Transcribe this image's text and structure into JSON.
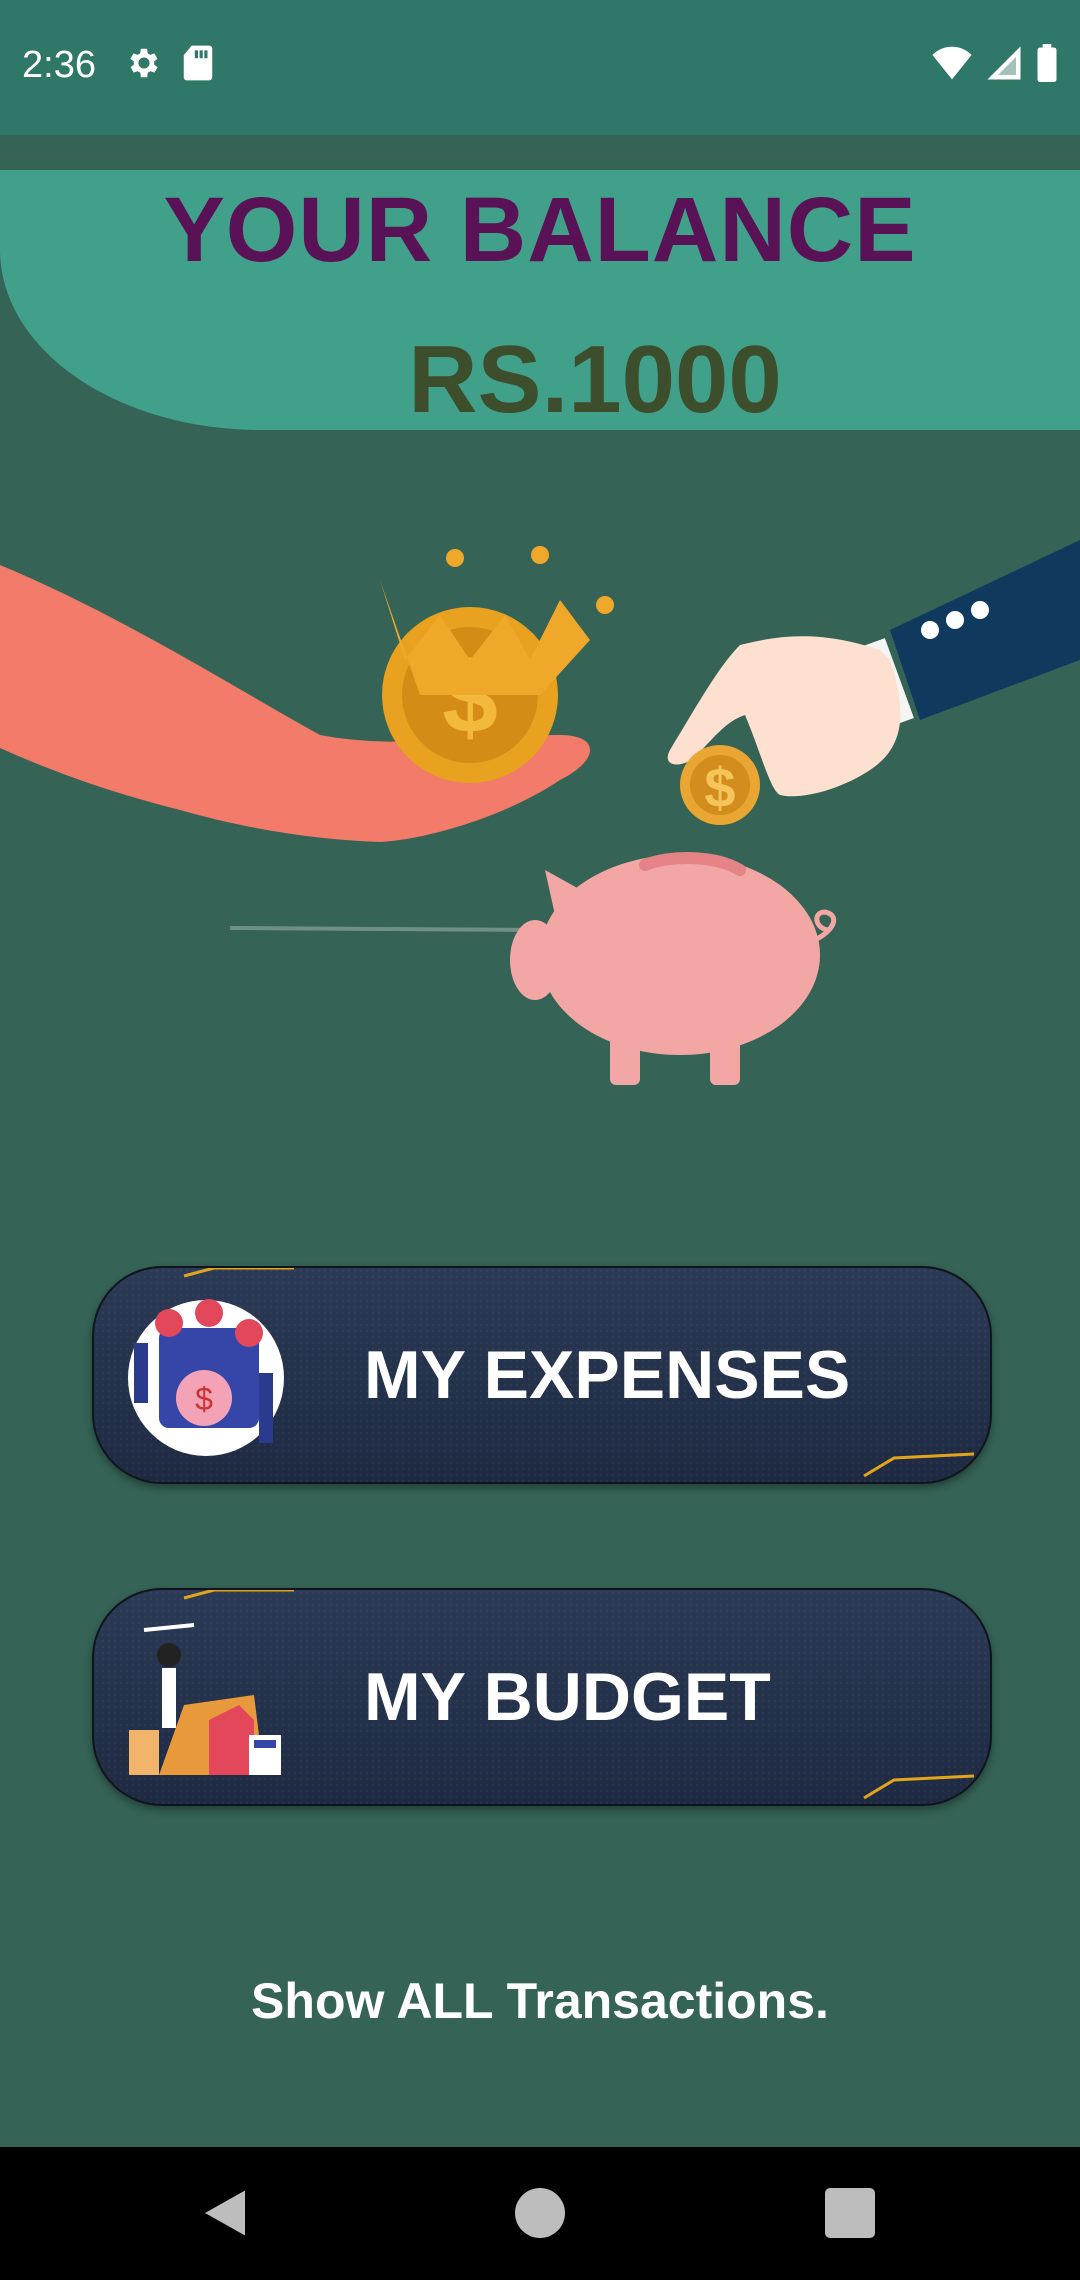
{
  "status_bar": {
    "time": "2:36",
    "left_icons": [
      "gear-icon",
      "sd-card-icon"
    ],
    "right_icons": [
      "wifi-icon",
      "signal-icon",
      "battery-icon"
    ]
  },
  "balance": {
    "title": "YOUR BALANCE",
    "amount": "RS.1000"
  },
  "menu": {
    "expenses_label": "MY EXPENSES",
    "budget_label": "MY BUDGET"
  },
  "show_all_label": "Show ALL Transactions.",
  "nav_bar": {
    "icons": [
      "back-icon",
      "home-icon",
      "recents-icon"
    ]
  },
  "colors": {
    "background": "#356356",
    "status_bar": "#2f7767",
    "header": "#41a08a",
    "title_text": "#5a1257",
    "amount_text": "#3c4e2c",
    "button_bg": "#243250",
    "accent_gold": "#e2a41c"
  }
}
